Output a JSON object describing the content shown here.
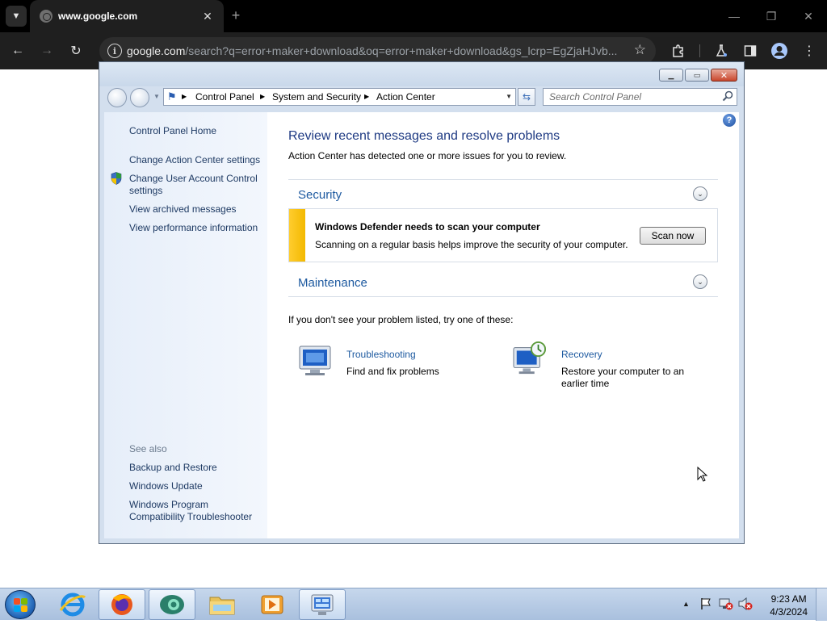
{
  "browser": {
    "tab_title": "www.google.com",
    "url_host": "google.com",
    "url_path": "/search?q=error+maker+download&oq=error+maker+download&gs_lcrp=EgZjaHJvb..."
  },
  "window": {
    "breadcrumb": [
      "Control Panel",
      "System and Security",
      "Action Center"
    ],
    "search_placeholder": "Search Control Panel"
  },
  "sidebar": {
    "home": "Control Panel Home",
    "links": {
      "action_center_settings": "Change Action Center settings",
      "uac_line1": "Change User Account Control",
      "uac_line2": "settings",
      "archived": "View archived messages",
      "performance": "View performance information"
    },
    "see_also_heading": "See also",
    "see_also": {
      "backup": "Backup and Restore",
      "windows_update": "Windows Update",
      "compat_line1": "Windows Program",
      "compat_line2": "Compatibility Troubleshooter"
    }
  },
  "main": {
    "title": "Review recent messages and resolve problems",
    "subtitle": "Action Center has detected one or more issues for you to review.",
    "security_label": "Security",
    "alert": {
      "title": "Windows Defender needs to scan your computer",
      "text": "Scanning on a regular basis helps improve the security of your computer.",
      "button": "Scan now"
    },
    "maintenance_label": "Maintenance",
    "hint": "If you don't see your problem listed, try one of these:",
    "troubleshooting": {
      "link": "Troubleshooting",
      "desc": "Find and fix problems"
    },
    "recovery": {
      "link": "Recovery",
      "desc_line1": "Restore your computer to an",
      "desc_line2": "earlier time"
    }
  },
  "taskbar": {
    "time": "9:23 AM",
    "date": "4/3/2024"
  },
  "colors": {
    "link": "#1e5aa0",
    "title": "#1e3a83",
    "alert_bar": "#f3b900"
  }
}
